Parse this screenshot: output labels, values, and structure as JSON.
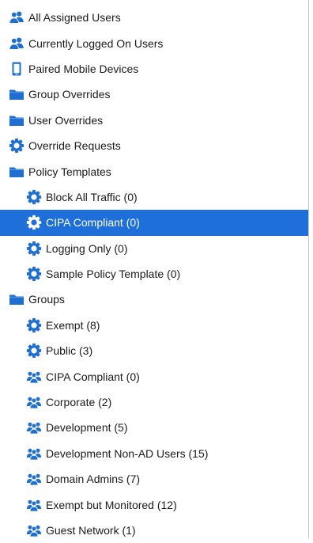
{
  "colors": {
    "icon_blue": "#1f6fd1",
    "selected_bg": "#1e6fd9",
    "text": "#1a1a1a"
  },
  "tree": {
    "items": [
      {
        "label": "All Assigned Users",
        "icon": "users-icon",
        "level": 0
      },
      {
        "label": "Currently Logged On Users",
        "icon": "users-icon",
        "level": 0
      },
      {
        "label": "Paired Mobile Devices",
        "icon": "mobile-device-icon",
        "level": 0
      },
      {
        "label": "Group Overrides",
        "icon": "folder-icon",
        "level": 0
      },
      {
        "label": "User Overrides",
        "icon": "folder-icon",
        "level": 0
      },
      {
        "label": "Override Requests",
        "icon": "gear-icon",
        "level": 0
      },
      {
        "label": "Policy Templates",
        "icon": "folder-icon",
        "level": 0
      },
      {
        "label": "Block All Traffic (0)",
        "icon": "gear-icon",
        "level": 1
      },
      {
        "label": "CIPA Compliant (0)",
        "icon": "gear-icon",
        "level": 1,
        "selected": true
      },
      {
        "label": "Logging Only (0)",
        "icon": "gear-icon",
        "level": 1
      },
      {
        "label": "Sample Policy Template (0)",
        "icon": "gear-icon",
        "level": 1
      },
      {
        "label": "Groups",
        "icon": "folder-icon",
        "level": 0
      },
      {
        "label": "Exempt (8)",
        "icon": "gear-icon",
        "level": 1
      },
      {
        "label": "Public (3)",
        "icon": "gear-icon",
        "level": 1
      },
      {
        "label": "CIPA Compliant (0)",
        "icon": "group-icon",
        "level": 1
      },
      {
        "label": "Corporate (2)",
        "icon": "group-icon",
        "level": 1
      },
      {
        "label": "Development (5)",
        "icon": "group-icon",
        "level": 1
      },
      {
        "label": "Development Non-AD Users (15)",
        "icon": "group-icon",
        "level": 1
      },
      {
        "label": "Domain Admins (7)",
        "icon": "group-icon",
        "level": 1
      },
      {
        "label": "Exempt but Monitored (12)",
        "icon": "group-icon",
        "level": 1
      },
      {
        "label": "Guest Network (1)",
        "icon": "group-icon",
        "level": 1
      }
    ]
  }
}
